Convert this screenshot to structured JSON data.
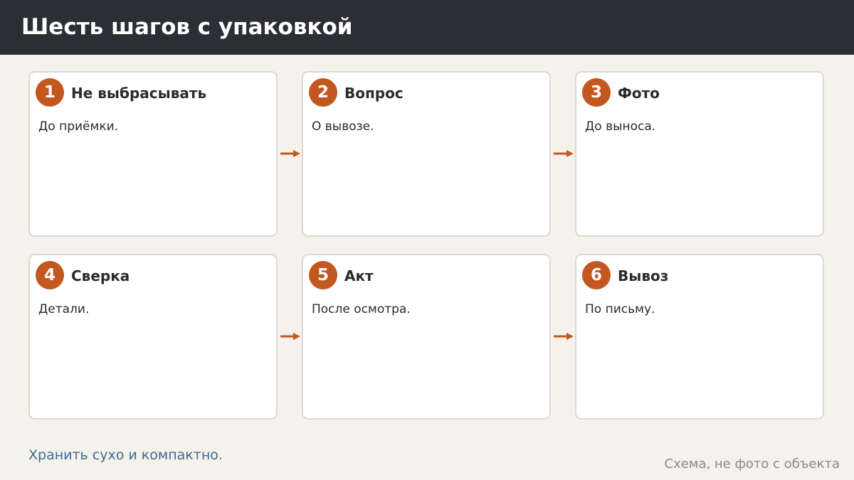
{
  "header": {
    "title": "Шесть шагов с упаковкой"
  },
  "steps": [
    {
      "number": "1",
      "title": "Не выбрасывать",
      "text": "До приёмки."
    },
    {
      "number": "2",
      "title": "Вопрос",
      "text": "О вывозе."
    },
    {
      "number": "3",
      "title": "Фото",
      "text": "До выноса."
    },
    {
      "number": "4",
      "title": "Сверка",
      "text": "Детали."
    },
    {
      "number": "5",
      "title": "Акт",
      "text": "После осмотра."
    },
    {
      "number": "6",
      "title": "Вывоз",
      "text": "По письму."
    }
  ],
  "footer": {
    "note": "Хранить сухо и компактно.",
    "caption": "Схема, не фото с объекта"
  },
  "colors": {
    "header_bg": "#2b2e33",
    "accent": "#c2571f",
    "page_bg": "#f5f1eb",
    "note_text": "#3d6b95",
    "caption_text": "#8a8a8a"
  },
  "icons": {
    "connector": "arrow-right-icon"
  }
}
